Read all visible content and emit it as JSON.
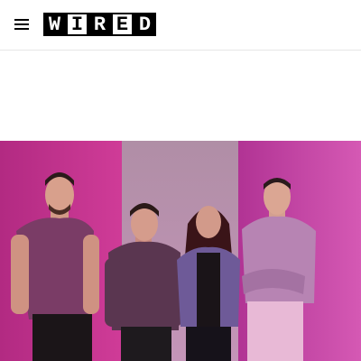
{
  "header": {
    "menu_icon": "hamburger-menu-icon",
    "logo": {
      "letters": [
        "W",
        "I",
        "R",
        "E",
        "D"
      ],
      "styles": [
        "dark",
        "light",
        "dark",
        "light",
        "dark"
      ]
    }
  },
  "hero": {
    "subject": "group-photo",
    "colors": {
      "magenta_left": "#c8318f",
      "magenta_right": "#c63aa0",
      "center_wall": "#b98aa8"
    }
  }
}
